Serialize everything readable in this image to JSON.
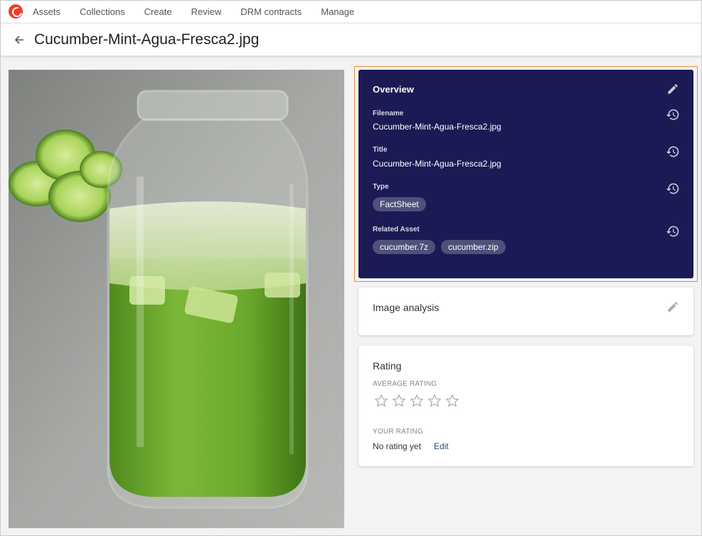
{
  "nav": {
    "items": [
      "Assets",
      "Collections",
      "Create",
      "Review",
      "DRM contracts",
      "Manage"
    ]
  },
  "header": {
    "title": "Cucumber-Mint-Agua-Fresca2.jpg"
  },
  "overview": {
    "title": "Overview",
    "fields": {
      "filename_label": "Filename",
      "filename_value": "Cucumber-Mint-Agua-Fresca2.jpg",
      "title_label": "Title",
      "title_value": "Cucumber-Mint-Agua-Fresca2.jpg",
      "type_label": "Type",
      "type_value": "FactSheet",
      "related_label": "Related Asset",
      "related_values": [
        "cucumber.7z",
        "cucumber.zip"
      ]
    }
  },
  "image_analysis": {
    "title": "Image analysis"
  },
  "rating": {
    "title": "Rating",
    "average_label": "AVERAGE RATING",
    "average_stars_filled": 0,
    "average_stars_total": 5,
    "your_label": "YOUR RATING",
    "your_value": "No rating yet",
    "edit_label": "Edit"
  },
  "colors": {
    "brand": "#e8402b",
    "overview_bg": "#1a1b54",
    "chip_bg": "#4f5179",
    "highlight_outline": "#e8883a"
  }
}
